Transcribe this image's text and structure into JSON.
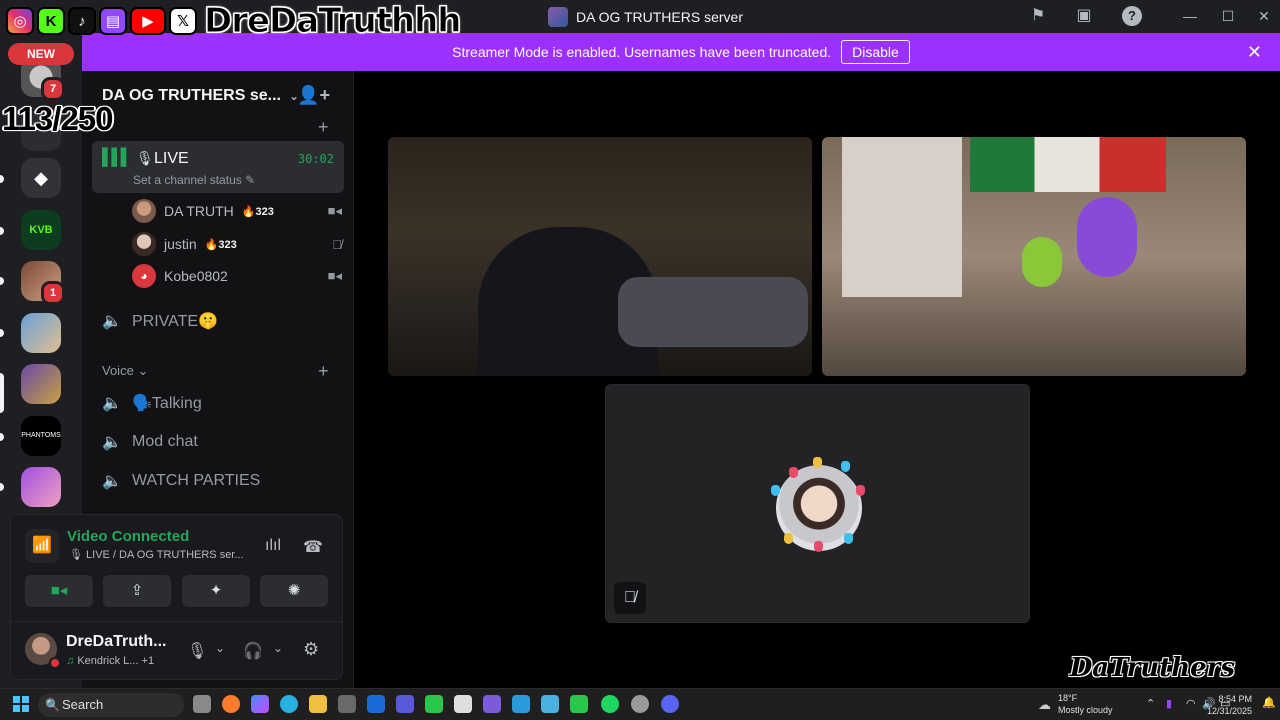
{
  "window": {
    "title": "DA OG TRUTHERS server",
    "icons": [
      "flag-icon",
      "inbox-icon",
      "help-icon"
    ],
    "controls": [
      "minimize-icon",
      "maximize-icon",
      "close-icon"
    ]
  },
  "overlay": {
    "handle": "DreDaTruthhh",
    "counter": "113/250",
    "watermark": "DaTruthers",
    "socials": [
      "instagram-icon",
      "kick-icon",
      "tiktok-icon",
      "twitch-icon",
      "youtube-icon",
      "x-icon"
    ]
  },
  "banner": {
    "text": "Streamer Mode is enabled. Usernames have been truncated.",
    "button": "Disable",
    "color": "#9b30ff"
  },
  "rail": {
    "new_label": "NEW",
    "badges": [
      "7",
      "1"
    ]
  },
  "sidebar": {
    "server_name": "DA OG TRUTHERS se...",
    "live_channel": {
      "name": "LIVE",
      "timer": "30:02",
      "status": "Set a channel status"
    },
    "members": [
      {
        "name": "DA TRUTH",
        "streak": "323"
      },
      {
        "name": "justin",
        "streak": "323"
      },
      {
        "name": "Kobe0802",
        "streak": ""
      }
    ],
    "channels_top": [
      {
        "name": "PRIVATE🤫"
      }
    ],
    "voice_category": "Voice",
    "voice_channels": [
      {
        "name": "🗣️Talking"
      },
      {
        "name": "Mod chat"
      },
      {
        "name": "WATCH PARTIES"
      }
    ]
  },
  "voice_panel": {
    "title": "Video Connected",
    "subtitle": "LIVE / DA OG TRUTHERS ser...",
    "accent": "#23a55a"
  },
  "user": {
    "name": "DreDaTruth...",
    "activity": "Kendrick L...",
    "activity_extra": "+1"
  },
  "taskbar": {
    "search": "Search",
    "weather_temp": "18°F",
    "weather_cond": "Mostly cloudy",
    "time": "8:54 PM",
    "date": "12/31/2025"
  }
}
